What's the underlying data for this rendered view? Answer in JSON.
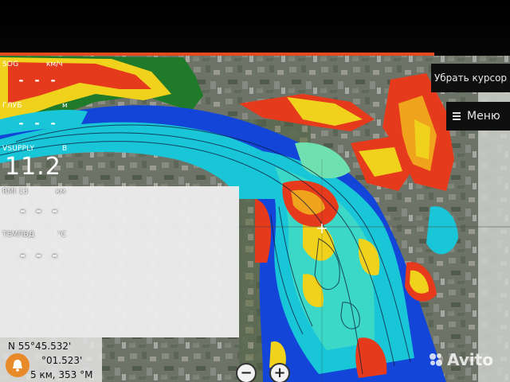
{
  "data_boxes": {
    "sog": {
      "label": "SOG",
      "unit": "км/ч",
      "value": "- - -"
    },
    "depth": {
      "label": "ГЛУБ",
      "unit": "м",
      "value": "- - -"
    },
    "vsupply": {
      "label": "VSUPPLY",
      "unit": "В",
      "value": "11.2"
    },
    "rmi": {
      "label": "RMI  13",
      "unit": "км",
      "value": "- - -"
    },
    "water_temp": {
      "label": "ТЕМПВД",
      "unit": "°C",
      "value": "- - -"
    }
  },
  "buttons": {
    "remove_cursor": "Убрать курсор",
    "menu": "Меню"
  },
  "cursor_info": {
    "lat": "N  55°45.532'",
    "lon": "°01.523'",
    "range_bearing": "5 км, 353 °М"
  },
  "zoom": {
    "out": "−",
    "in": "+"
  },
  "watermark": "Avito",
  "icons": {
    "menu": "hamburger-menu-icon",
    "alarm": "bell-alarm-icon",
    "watermark": "avito-dots-icon"
  },
  "colors": {
    "accent_orange": "#e34a1e",
    "deep_water": "#1346d8",
    "shallow_water": "#19c6d8",
    "mid_shallow": "#3bd8c8"
  }
}
